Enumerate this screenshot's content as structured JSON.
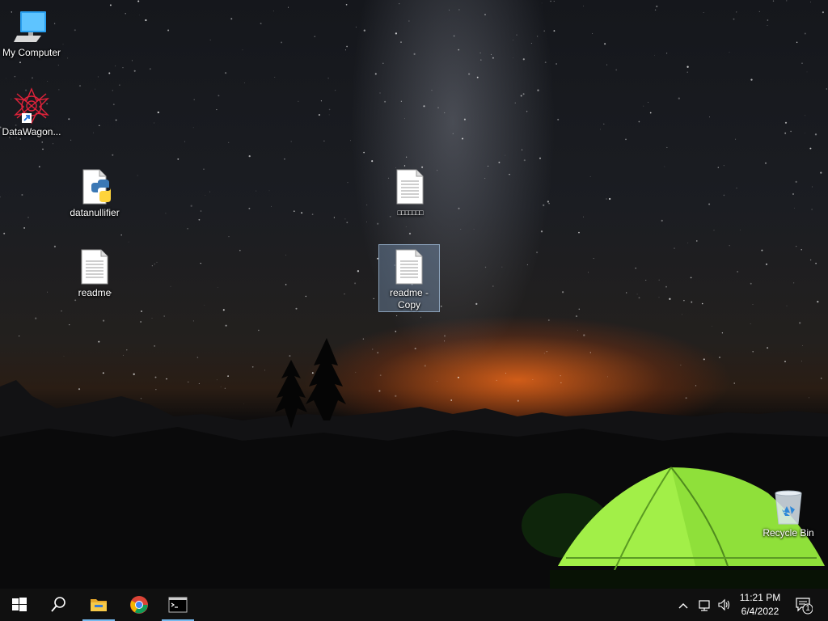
{
  "desktop": {
    "icons": [
      {
        "id": "my-computer",
        "label": "My Computer"
      },
      {
        "id": "datawagon",
        "label": "DataWagon..."
      },
      {
        "id": "datanullifier",
        "label": "datanullifier"
      },
      {
        "id": "readme",
        "label": "readme"
      },
      {
        "id": "unnamed-file",
        "label": "□□□□□□□"
      },
      {
        "id": "readme-copy",
        "label": "readme - Copy",
        "selected": true
      },
      {
        "id": "recycle-bin",
        "label": "Recycle Bin"
      }
    ]
  },
  "taskbar": {
    "start_icon": "windows-start-icon",
    "search_icon": "search-icon",
    "pinned": [
      {
        "name": "file-explorer",
        "icon": "folder-icon",
        "active": true
      },
      {
        "name": "chrome",
        "icon": "chrome-icon",
        "active": false
      },
      {
        "name": "command-prompt",
        "icon": "terminal-icon",
        "active": true
      }
    ],
    "tray": {
      "time": "11:21 PM",
      "date": "6/4/2022",
      "notification_count": "1"
    }
  },
  "colors": {
    "taskbar": "#101010",
    "active_indicator": "#76b9ed",
    "selection": "#8cafd7"
  }
}
